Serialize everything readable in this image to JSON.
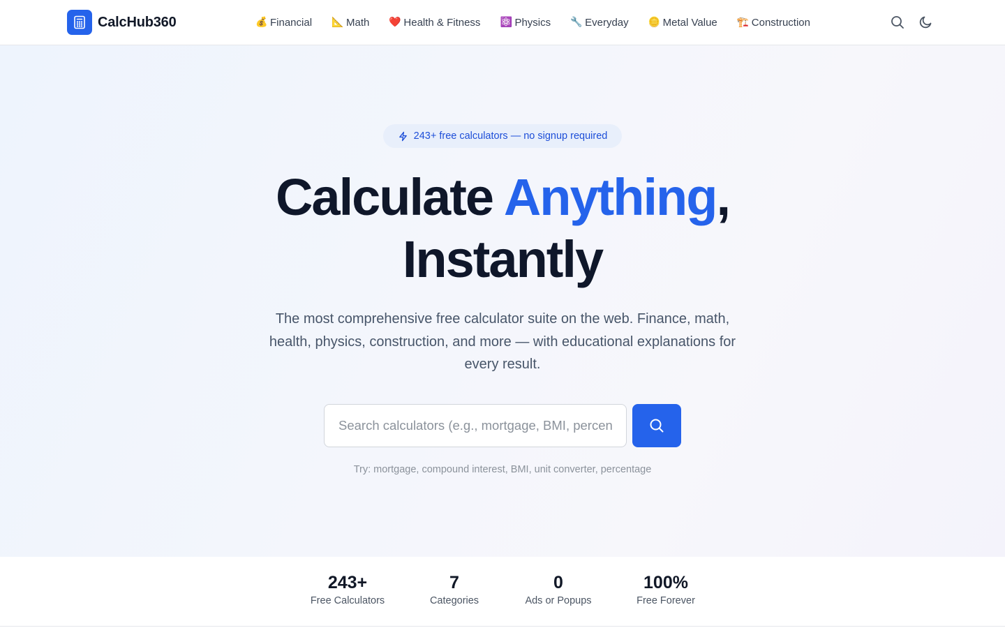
{
  "brand": {
    "name": "CalcHub360",
    "accent": "#2563eb"
  },
  "nav": [
    {
      "emoji": "💰",
      "label": "Financial"
    },
    {
      "emoji": "📐",
      "label": "Math"
    },
    {
      "emoji": "❤️",
      "label": "Health & Fitness"
    },
    {
      "emoji": "⚛️",
      "label": "Physics"
    },
    {
      "emoji": "🔧",
      "label": "Everyday"
    },
    {
      "emoji": "🪙",
      "label": "Metal Value"
    },
    {
      "emoji": "🏗️",
      "label": "Construction"
    }
  ],
  "header_icons": [
    "search-icon",
    "moon-icon"
  ],
  "hero": {
    "badge": "243+ free calculators — no signup required",
    "title_part1": "Calculate ",
    "title_accent": "Anything",
    "title_comma": ",",
    "title_line2": "Instantly",
    "subtitle": "The most comprehensive free calculator suite on the web. Finance, math, health, physics, construction, and more — with educational explanations for every result.",
    "search_placeholder": "Search calculators (e.g., mortgage, BMI, percentage)",
    "search_value": "",
    "try_text": "Try: mortgage, compound interest, BMI, unit converter, percentage"
  },
  "stats": [
    {
      "value": "243+",
      "label": "Free Calculators"
    },
    {
      "value": "7",
      "label": "Categories"
    },
    {
      "value": "0",
      "label": "Ads or Popups"
    },
    {
      "value": "100%",
      "label": "Free Forever"
    }
  ]
}
